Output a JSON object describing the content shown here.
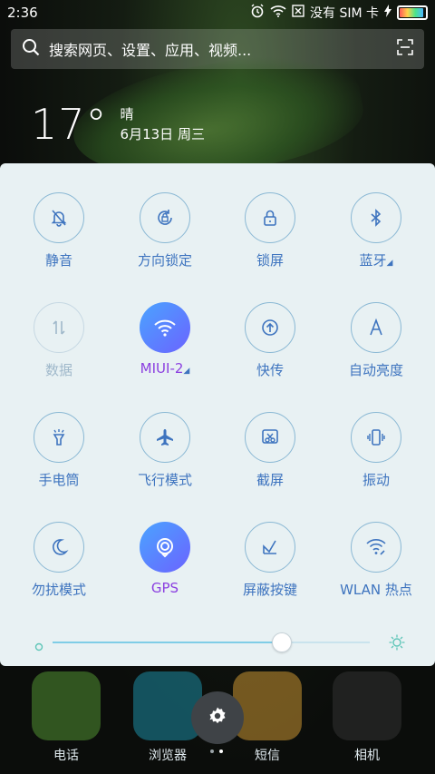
{
  "status": {
    "time": "2:36",
    "network": "没有 SIM 卡"
  },
  "search": {
    "placeholder": "搜索网页、设置、应用、视频..."
  },
  "weather": {
    "temperature": "17°",
    "condition": "晴",
    "date": "6月13日 周三"
  },
  "quick_settings": [
    {
      "label": "静音"
    },
    {
      "label": "方向锁定"
    },
    {
      "label": "锁屏"
    },
    {
      "label": "蓝牙"
    },
    {
      "label": "数据"
    },
    {
      "label": "MIUI-2"
    },
    {
      "label": "快传"
    },
    {
      "label": "自动亮度"
    },
    {
      "label": "手电筒"
    },
    {
      "label": "飞行模式"
    },
    {
      "label": "截屏"
    },
    {
      "label": "振动"
    },
    {
      "label": "勿扰模式"
    },
    {
      "label": "GPS"
    },
    {
      "label": "屏蔽按键"
    },
    {
      "label": "WLAN 热点"
    }
  ],
  "brightness": {
    "level": 0.72
  },
  "dock": [
    {
      "label": "电话"
    },
    {
      "label": "浏览器"
    },
    {
      "label": "短信"
    },
    {
      "label": "相机"
    }
  ],
  "colors": {
    "accent": "#3e74bf",
    "active": "#4aa4ff",
    "purple": "#8b3fe0",
    "panel": "#e8f1f3"
  }
}
